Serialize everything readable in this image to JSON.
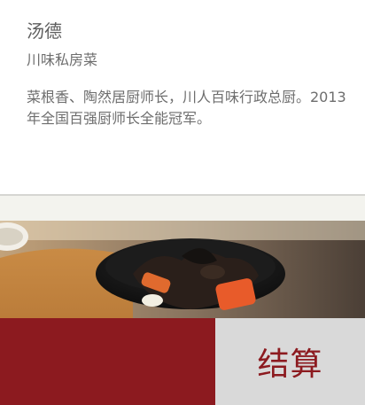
{
  "chef": {
    "name": "汤德",
    "cuisine": "川味私房菜",
    "bio": "菜根香、陶然居厨师长，川人百味行政总厨。2013年全国百强厨师长全能冠军。"
  },
  "cart": {
    "checkout_label": "结算"
  },
  "colors": {
    "accent": "#8c1a1f",
    "checkout_bg": "#d9d9d9"
  }
}
